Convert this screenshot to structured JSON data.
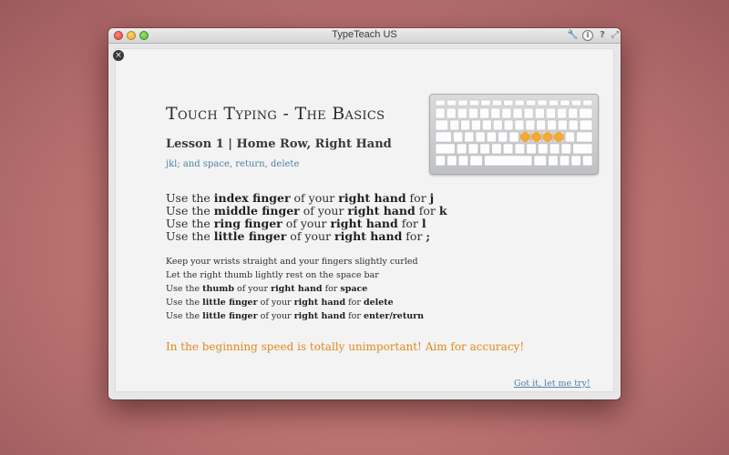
{
  "window": {
    "title": "TypeTeach US",
    "toolbar_icons": [
      "wrench-icon",
      "info-icon",
      "help-icon",
      "expand-icon"
    ],
    "toolbar_glyphs": {
      "wrench": "🔧",
      "info": "i",
      "help": "?",
      "expand": "⤢"
    }
  },
  "lesson": {
    "close_glyph": "×",
    "title": "Touch Typing - The Basics",
    "subtitle": "Lesson 1 | Home Row, Right Hand",
    "keys": "jkl; and space, return, delete",
    "finger_rules": [
      {
        "pre": "Use the ",
        "finger": "index finger",
        "mid": " of your ",
        "hand": "right hand",
        "post": " for ",
        "key": "j"
      },
      {
        "pre": "Use the ",
        "finger": "middle finger",
        "mid": " of your ",
        "hand": "right hand",
        "post": " for ",
        "key": "k"
      },
      {
        "pre": "Use the ",
        "finger": "ring finger",
        "mid": " of your ",
        "hand": "right hand",
        "post": " for ",
        "key": "l"
      },
      {
        "pre": "Use the ",
        "finger": "little finger",
        "mid": " of your ",
        "hand": "right hand",
        "post": " for ",
        "key": ";"
      }
    ],
    "tips": [
      {
        "text": "Keep your wrists straight and your fingers slightly curled"
      },
      {
        "text": "Let the right thumb lightly rest on the space bar"
      },
      {
        "pre": "Use the ",
        "finger": "thumb",
        "mid": " of your ",
        "hand": "right hand",
        "post": " for ",
        "key": "space"
      },
      {
        "pre": "Use the ",
        "finger": "little finger",
        "mid": " of your ",
        "hand": "right hand",
        "post": " for ",
        "key": "delete"
      },
      {
        "pre": "Use the ",
        "finger": "little finger",
        "mid": " of your ",
        "hand": "right hand",
        "post": " for ",
        "key": "enter/return"
      }
    ],
    "accuracy_tip": "In the beginning speed is totally unimportant! Aim for accuracy!",
    "button": "Got it, let me try!"
  },
  "keyboard_preview": {
    "highlighted_keys": [
      "J",
      "K",
      "L",
      ";"
    ],
    "highlight_color": "#f2a227"
  },
  "colors": {
    "heading": "#2b2b2b",
    "link": "#4c83a8",
    "tip": "#e08a1e"
  }
}
